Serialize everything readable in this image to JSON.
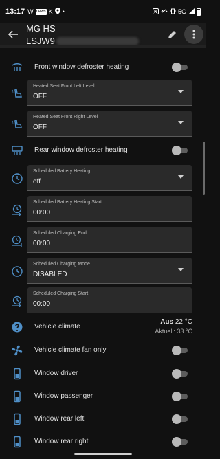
{
  "status_bar": {
    "time": "13:17",
    "left_icons": [
      "W",
      "news",
      "K",
      "location-icon",
      "•"
    ],
    "right_text": "5G"
  },
  "app_bar": {
    "title": "MG HS",
    "subtitle": "LSJW9",
    "subtitle_redacted": true
  },
  "entities": [
    {
      "type": "toggle",
      "icon": "defroster-front-icon",
      "label": "Front window defroster heating",
      "on": false
    },
    {
      "type": "select",
      "icon": "heated-seat-icon",
      "label": "Heated Seat Front Left Level",
      "value": "OFF"
    },
    {
      "type": "select",
      "icon": "heated-seat-icon",
      "label": "Heated Seat Front Right Level",
      "value": "OFF"
    },
    {
      "type": "toggle",
      "icon": "defroster-rear-icon",
      "label": "Rear window defroster heating",
      "on": false
    },
    {
      "type": "select",
      "icon": "clock-icon",
      "label": "Scheduled Battery Heating",
      "value": "off"
    },
    {
      "type": "time",
      "icon": "clock-start-icon",
      "label": "Scheduled Battery Heating Start",
      "value": "00:00"
    },
    {
      "type": "time",
      "icon": "clock-end-icon",
      "label": "Scheduled Charging End",
      "value": "00:00"
    },
    {
      "type": "select",
      "icon": "clock-icon",
      "label": "Scheduled Charging Mode",
      "value": "DISABLED"
    },
    {
      "type": "time",
      "icon": "clock-start-icon",
      "label": "Scheduled Charging Start",
      "value": "00:00"
    },
    {
      "type": "climate",
      "icon": "thermostat-icon",
      "label": "Vehicle climate",
      "state": "Aus",
      "target": "22 °C",
      "current": "Aktuell: 33 °C"
    },
    {
      "type": "toggle",
      "icon": "fan-icon",
      "label": "Vehicle climate fan only",
      "on": false
    },
    {
      "type": "toggle",
      "icon": "window-icon",
      "label": "Window driver",
      "on": false
    },
    {
      "type": "toggle",
      "icon": "window-icon",
      "label": "Window passenger",
      "on": false
    },
    {
      "type": "toggle",
      "icon": "window-icon",
      "label": "Window rear left",
      "on": false
    },
    {
      "type": "toggle",
      "icon": "window-icon",
      "label": "Window rear right",
      "on": false
    }
  ],
  "colors": {
    "accent_icon": "#4f8fc7",
    "background": "#111111",
    "field_bg": "#2a2a2a"
  }
}
